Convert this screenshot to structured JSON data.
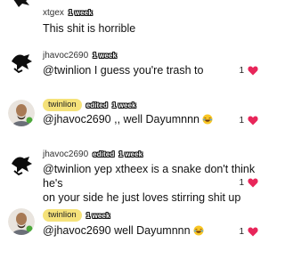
{
  "comments": [
    {
      "user": "xtgex",
      "tags": [
        "1 week"
      ],
      "text": "This shit is horrible",
      "likes": ""
    },
    {
      "user": "jhavoc2690",
      "tags": [
        "1 week"
      ],
      "text": "@twinlion I guess you're trash to",
      "likes": "1"
    },
    {
      "user": "twinlion",
      "tags": [
        "edited",
        "1 week"
      ],
      "text": "@jhavoc2690 ,,  well Dayumnnn",
      "likes": "1"
    },
    {
      "user": "jhavoc2690",
      "tags": [
        "edited",
        "1 week"
      ],
      "text_line1": "@twinlion yep xtheex is a snake don't think he's",
      "text_line2": "on your side he just loves stirring shit up",
      "likes": "1"
    },
    {
      "user": "twinlion",
      "tags": [
        "1 week"
      ],
      "text": "@jhavoc2690 well Dayumnnn",
      "likes": "1"
    }
  ],
  "colors": {
    "heart": "#e8265a",
    "pill": "#f5e27a"
  }
}
